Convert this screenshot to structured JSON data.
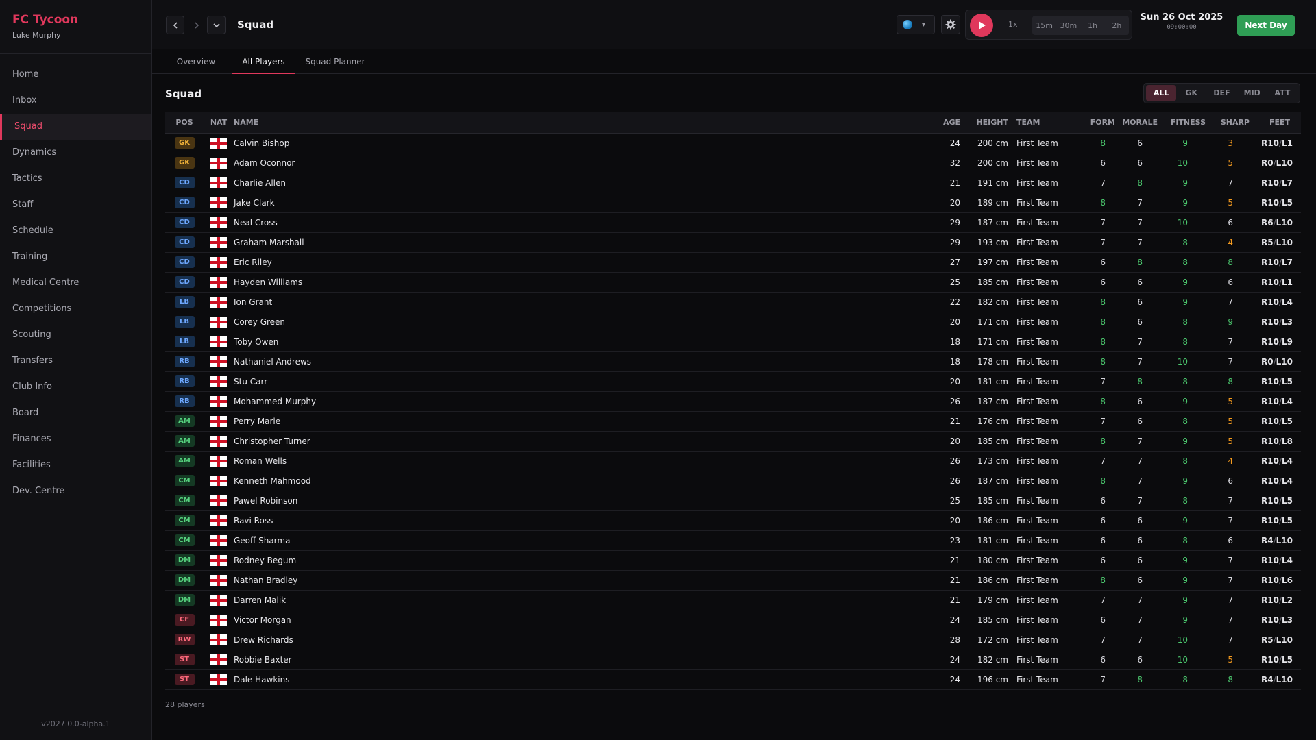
{
  "app": {
    "title": "FC Tycoon",
    "manager": "Luke Murphy",
    "version": "v2027.0.0-alpha.1"
  },
  "nav": [
    "Home",
    "Inbox",
    "Squad",
    "Dynamics",
    "Tactics",
    "Staff",
    "Schedule",
    "Training",
    "Medical Centre",
    "Competitions",
    "Scouting",
    "Transfers",
    "Club Info",
    "Board",
    "Finances",
    "Facilities",
    "Dev. Centre"
  ],
  "nav_active": "Squad",
  "header": {
    "title": "Squad",
    "speeds": [
      "15m",
      "30m",
      "1h",
      "2h"
    ],
    "speed_current": "1x",
    "date": "Sun 26 Oct 2025",
    "time": "09:00:00",
    "next_day": "Next Day"
  },
  "tabs": [
    "Overview",
    "All Players",
    "Squad Planner"
  ],
  "tab_active": "All Players",
  "section_title": "Squad",
  "filters": [
    "ALL",
    "GK",
    "DEF",
    "MID",
    "ATT"
  ],
  "filter_active": "ALL",
  "columns": {
    "pos": "POS",
    "nat": "NAT",
    "name": "NAME",
    "age": "AGE",
    "height": "HEIGHT",
    "team": "TEAM",
    "form": "FORM",
    "morale": "MORALE",
    "fitness": "FITNESS",
    "sharp": "SHARP",
    "feet": "FEET"
  },
  "colors": {
    "accent": "#e0385c",
    "green": "#4cc86e",
    "orange": "#f39a1f",
    "next_day": "#2f9e55"
  },
  "players": [
    {
      "pos": "GK",
      "name": "Calvin Bishop",
      "age": "24",
      "height": "200 cm",
      "team": "First Team",
      "form": "8",
      "morale": "6",
      "fitness": "9",
      "sharp": "3",
      "r": "R10",
      "l": "L1"
    },
    {
      "pos": "GK",
      "name": "Adam Oconnor",
      "age": "32",
      "height": "200 cm",
      "team": "First Team",
      "form": "6",
      "morale": "6",
      "fitness": "10",
      "sharp": "5",
      "r": "R0",
      "l": "L10"
    },
    {
      "pos": "CD",
      "name": "Charlie Allen",
      "age": "21",
      "height": "191 cm",
      "team": "First Team",
      "form": "7",
      "morale": "8",
      "fitness": "9",
      "sharp": "7",
      "r": "R10",
      "l": "L7"
    },
    {
      "pos": "CD",
      "name": "Jake Clark",
      "age": "20",
      "height": "189 cm",
      "team": "First Team",
      "form": "8",
      "morale": "7",
      "fitness": "9",
      "sharp": "5",
      "r": "R10",
      "l": "L5"
    },
    {
      "pos": "CD",
      "name": "Neal Cross",
      "age": "29",
      "height": "187 cm",
      "team": "First Team",
      "form": "7",
      "morale": "7",
      "fitness": "10",
      "sharp": "6",
      "r": "R6",
      "l": "L10"
    },
    {
      "pos": "CD",
      "name": "Graham Marshall",
      "age": "29",
      "height": "193 cm",
      "team": "First Team",
      "form": "7",
      "morale": "7",
      "fitness": "8",
      "sharp": "4",
      "r": "R5",
      "l": "L10"
    },
    {
      "pos": "CD",
      "name": "Eric Riley",
      "age": "27",
      "height": "197 cm",
      "team": "First Team",
      "form": "6",
      "morale": "8",
      "fitness": "8",
      "sharp": "8",
      "r": "R10",
      "l": "L7"
    },
    {
      "pos": "CD",
      "name": "Hayden Williams",
      "age": "25",
      "height": "185 cm",
      "team": "First Team",
      "form": "6",
      "morale": "6",
      "fitness": "9",
      "sharp": "6",
      "r": "R10",
      "l": "L1"
    },
    {
      "pos": "LB",
      "name": "Ion Grant",
      "age": "22",
      "height": "182 cm",
      "team": "First Team",
      "form": "8",
      "morale": "6",
      "fitness": "9",
      "sharp": "7",
      "r": "R10",
      "l": "L4"
    },
    {
      "pos": "LB",
      "name": "Corey Green",
      "age": "20",
      "height": "171 cm",
      "team": "First Team",
      "form": "8",
      "morale": "6",
      "fitness": "8",
      "sharp": "9",
      "r": "R10",
      "l": "L3"
    },
    {
      "pos": "LB",
      "name": "Toby Owen",
      "age": "18",
      "height": "171 cm",
      "team": "First Team",
      "form": "8",
      "morale": "7",
      "fitness": "8",
      "sharp": "7",
      "r": "R10",
      "l": "L9"
    },
    {
      "pos": "RB",
      "name": "Nathaniel Andrews",
      "age": "18",
      "height": "178 cm",
      "team": "First Team",
      "form": "8",
      "morale": "7",
      "fitness": "10",
      "sharp": "7",
      "r": "R0",
      "l": "L10"
    },
    {
      "pos": "RB",
      "name": "Stu Carr",
      "age": "20",
      "height": "181 cm",
      "team": "First Team",
      "form": "7",
      "morale": "8",
      "fitness": "8",
      "sharp": "8",
      "r": "R10",
      "l": "L5"
    },
    {
      "pos": "RB",
      "name": "Mohammed Murphy",
      "age": "26",
      "height": "187 cm",
      "team": "First Team",
      "form": "8",
      "morale": "6",
      "fitness": "9",
      "sharp": "5",
      "r": "R10",
      "l": "L4"
    },
    {
      "pos": "AM",
      "name": "Perry Marie",
      "age": "21",
      "height": "176 cm",
      "team": "First Team",
      "form": "7",
      "morale": "6",
      "fitness": "8",
      "sharp": "5",
      "r": "R10",
      "l": "L5"
    },
    {
      "pos": "AM",
      "name": "Christopher Turner",
      "age": "20",
      "height": "185 cm",
      "team": "First Team",
      "form": "8",
      "morale": "7",
      "fitness": "9",
      "sharp": "5",
      "r": "R10",
      "l": "L8"
    },
    {
      "pos": "AM",
      "name": "Roman Wells",
      "age": "26",
      "height": "173 cm",
      "team": "First Team",
      "form": "7",
      "morale": "7",
      "fitness": "8",
      "sharp": "4",
      "r": "R10",
      "l": "L4"
    },
    {
      "pos": "CM",
      "name": "Kenneth Mahmood",
      "age": "26",
      "height": "187 cm",
      "team": "First Team",
      "form": "8",
      "morale": "7",
      "fitness": "9",
      "sharp": "6",
      "r": "R10",
      "l": "L4"
    },
    {
      "pos": "CM",
      "name": "Pawel Robinson",
      "age": "25",
      "height": "185 cm",
      "team": "First Team",
      "form": "6",
      "morale": "7",
      "fitness": "8",
      "sharp": "7",
      "r": "R10",
      "l": "L5"
    },
    {
      "pos": "CM",
      "name": "Ravi Ross",
      "age": "20",
      "height": "186 cm",
      "team": "First Team",
      "form": "6",
      "morale": "6",
      "fitness": "9",
      "sharp": "7",
      "r": "R10",
      "l": "L5"
    },
    {
      "pos": "CM",
      "name": "Geoff Sharma",
      "age": "23",
      "height": "181 cm",
      "team": "First Team",
      "form": "6",
      "morale": "6",
      "fitness": "8",
      "sharp": "6",
      "r": "R4",
      "l": "L10"
    },
    {
      "pos": "DM",
      "name": "Rodney Begum",
      "age": "21",
      "height": "180 cm",
      "team": "First Team",
      "form": "6",
      "morale": "6",
      "fitness": "9",
      "sharp": "7",
      "r": "R10",
      "l": "L4"
    },
    {
      "pos": "DM",
      "name": "Nathan Bradley",
      "age": "21",
      "height": "186 cm",
      "team": "First Team",
      "form": "8",
      "morale": "6",
      "fitness": "9",
      "sharp": "7",
      "r": "R10",
      "l": "L6"
    },
    {
      "pos": "DM",
      "name": "Darren Malik",
      "age": "21",
      "height": "179 cm",
      "team": "First Team",
      "form": "7",
      "morale": "7",
      "fitness": "9",
      "sharp": "7",
      "r": "R10",
      "l": "L2"
    },
    {
      "pos": "CF",
      "name": "Victor Morgan",
      "age": "24",
      "height": "185 cm",
      "team": "First Team",
      "form": "6",
      "morale": "7",
      "fitness": "9",
      "sharp": "7",
      "r": "R10",
      "l": "L3"
    },
    {
      "pos": "RW",
      "name": "Drew Richards",
      "age": "28",
      "height": "172 cm",
      "team": "First Team",
      "form": "7",
      "morale": "7",
      "fitness": "10",
      "sharp": "7",
      "r": "R5",
      "l": "L10"
    },
    {
      "pos": "ST",
      "name": "Robbie Baxter",
      "age": "24",
      "height": "182 cm",
      "team": "First Team",
      "form": "6",
      "morale": "6",
      "fitness": "10",
      "sharp": "5",
      "r": "R10",
      "l": "L5"
    },
    {
      "pos": "ST",
      "name": "Dale Hawkins",
      "age": "24",
      "height": "196 cm",
      "team": "First Team",
      "form": "7",
      "morale": "8",
      "fitness": "8",
      "sharp": "8",
      "r": "R4",
      "l": "L10"
    }
  ],
  "footer": "28 players"
}
